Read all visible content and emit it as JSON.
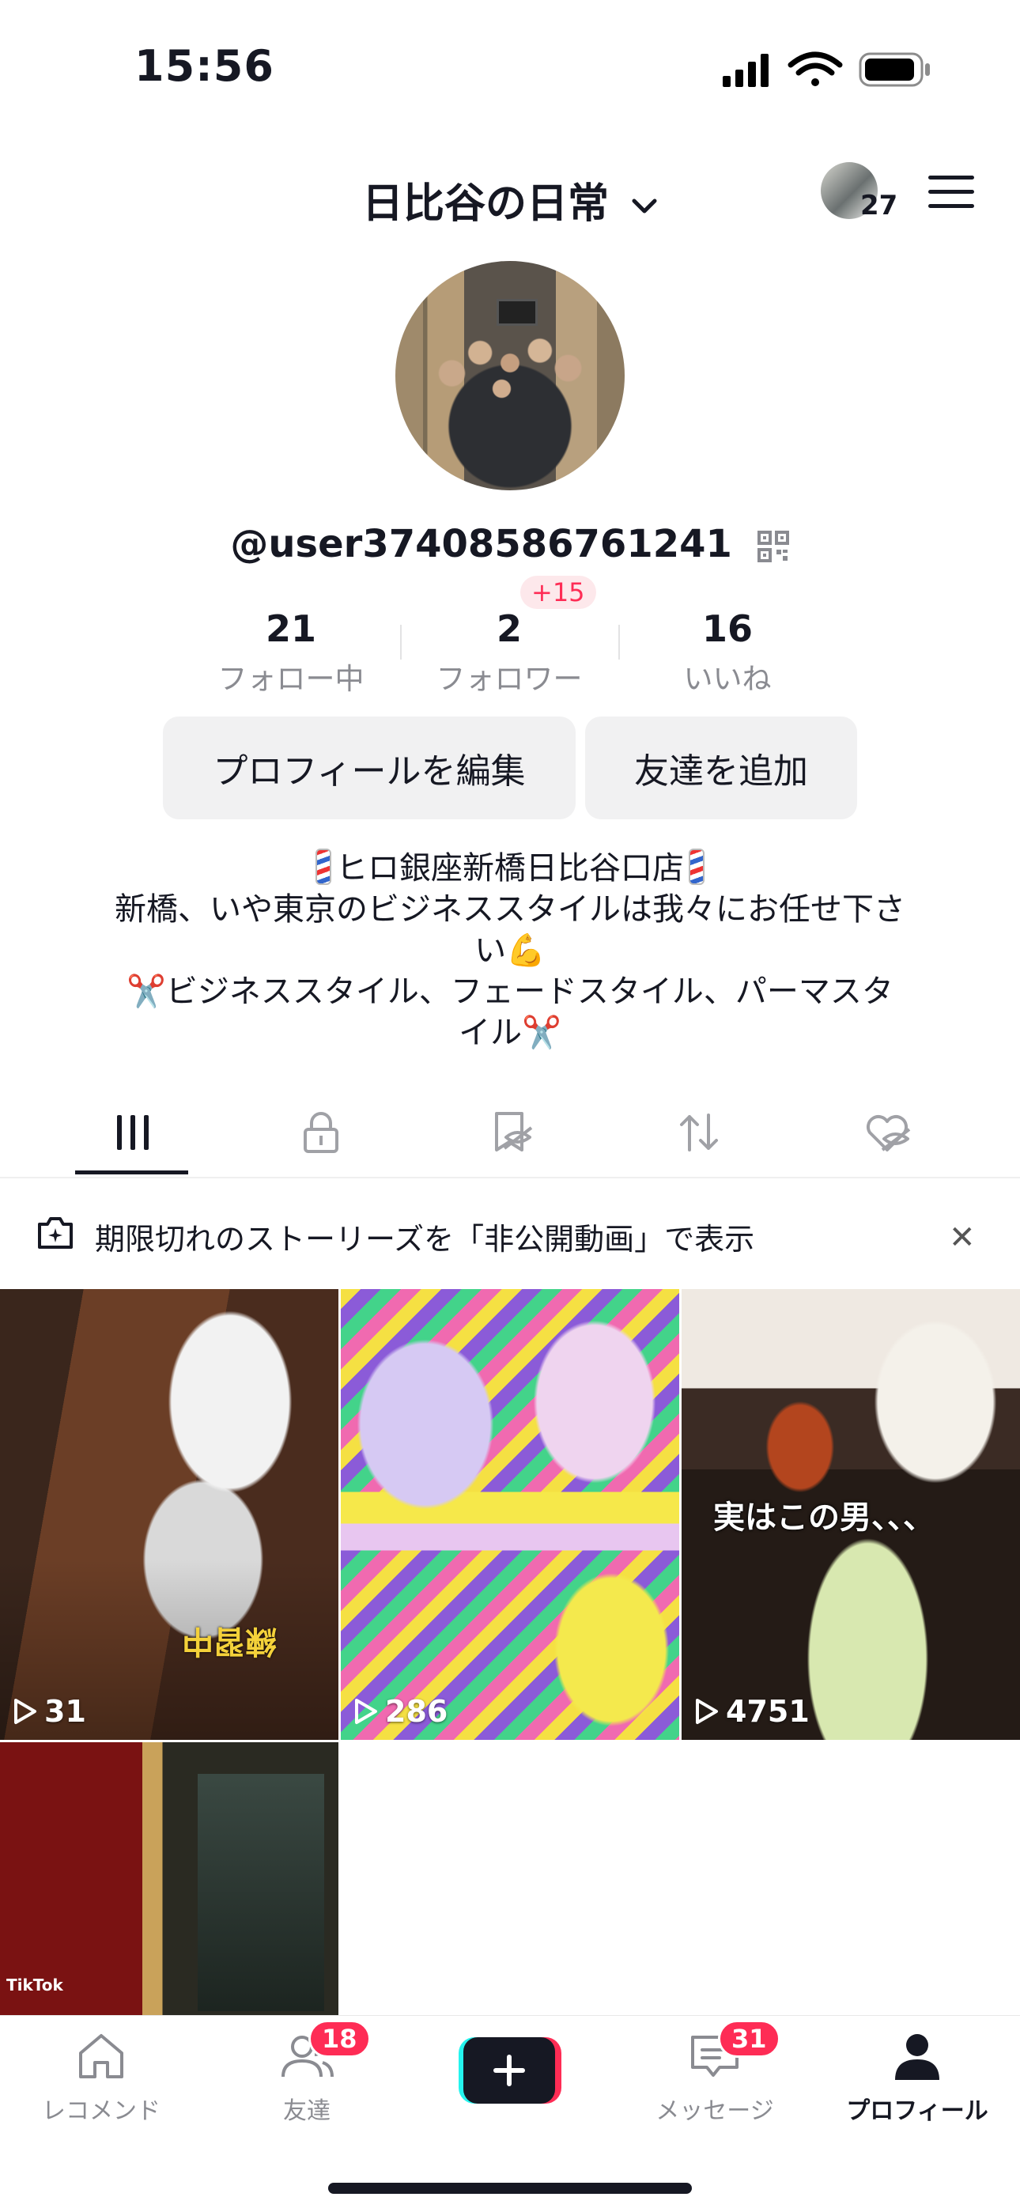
{
  "status_bar": {
    "time": "15:56"
  },
  "header": {
    "account_name": "日比谷の日常",
    "mini_avatar_count": "27"
  },
  "profile": {
    "username": "@user37408586761241",
    "stats": [
      {
        "value": "21",
        "label": "フォロー中"
      },
      {
        "value": "2",
        "label": "フォロワー",
        "badge": "+15"
      },
      {
        "value": "16",
        "label": "いいね"
      }
    ],
    "buttons": {
      "edit": "プロフィールを編集",
      "add_friend": "友達を追加"
    },
    "bio": {
      "line1": "ヒロ銀座新橋日比谷口店",
      "line2": "新橋、いや東京のビジネススタイルは我々にお任せ下さ",
      "line3": "い💪",
      "line4": "✂️ビジネススタイル、フェードスタイル、パーマスタ",
      "line5": "イル✂️"
    }
  },
  "tabs": {
    "icons": [
      "grid-icon",
      "lock-icon",
      "bookmark-hidden-icon",
      "repost-icon",
      "liked-hidden-icon"
    ],
    "active_index": 0
  },
  "story_notice": {
    "text": "期限切れのストーリーズを「非公開動画」で表示"
  },
  "videos": [
    {
      "views": "31",
      "overlay_text": "練習中"
    },
    {
      "views": "286"
    },
    {
      "views": "4751",
      "caption": "実はこの男、、、"
    },
    {
      "watermark": "TikTok"
    }
  ],
  "bottom_nav": [
    {
      "label": "レコメンド"
    },
    {
      "label": "友達",
      "badge": "18"
    },
    {
      "label": ""
    },
    {
      "label": "メッセージ",
      "badge": "31"
    },
    {
      "label": "プロフィール"
    }
  ],
  "colors": {
    "accent": "#fe2c55",
    "text": "#161823",
    "muted": "#8a8b91"
  }
}
